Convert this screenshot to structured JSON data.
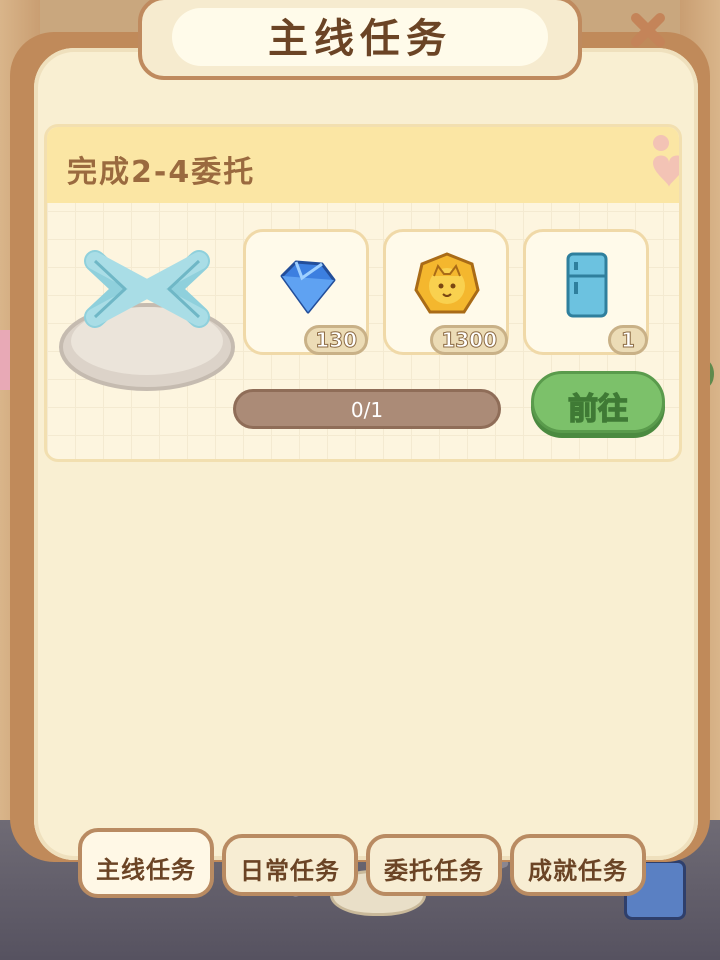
{
  "title": "主线任务",
  "task": {
    "title": "完成2-4委托",
    "rewards": [
      {
        "icon": "blue-diamond-icon",
        "count": "130"
      },
      {
        "icon": "gold-cat-coin-icon",
        "count": "1300"
      },
      {
        "icon": "blue-refrigerator-icon",
        "count": "1"
      }
    ],
    "progress": {
      "current": 0,
      "total": 1,
      "label": "0/1"
    },
    "go_label": "前往"
  },
  "tabs": [
    {
      "label": "主线任务",
      "active": true
    },
    {
      "label": "日常任务",
      "active": false
    },
    {
      "label": "委托任务",
      "active": false
    },
    {
      "label": "成就任务",
      "active": false
    }
  ],
  "colors": {
    "panel_border": "#c08a5a",
    "panel_fill": "#f9efd2",
    "title_text": "#6b4425",
    "header_band": "#fbe6a4",
    "task_title": "#9a6a3f",
    "go_button": "#7cc16a",
    "progress_track": "#ab8b77"
  }
}
